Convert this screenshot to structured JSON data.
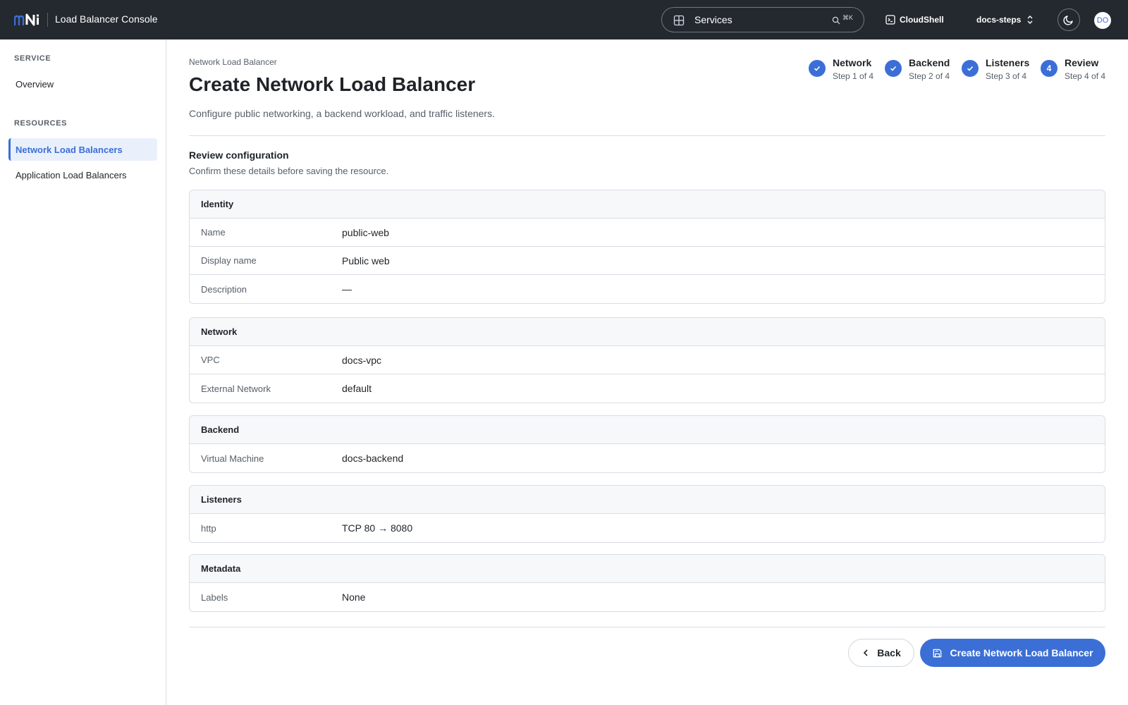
{
  "colors": {
    "accent": "#3b6fd6",
    "topbar": "#24292f"
  },
  "topbar": {
    "logo_text": "mNi",
    "app_title": "Load Balancer Console",
    "search": {
      "label": "Services",
      "shortcut": "⌘K"
    },
    "cloudshell_label": "CloudShell",
    "project_label": "docs-steps",
    "avatar_initials": "DO",
    "icons": [
      "grid-icon",
      "search-icon",
      "terminal-icon",
      "chevron-up-down-icon",
      "moon-icon"
    ]
  },
  "sidebar": {
    "sections": [
      {
        "heading": "SERVICE",
        "items": [
          {
            "label": "Overview",
            "active": false
          }
        ]
      },
      {
        "heading": "RESOURCES",
        "items": [
          {
            "label": "Network Load Balancers",
            "active": true
          },
          {
            "label": "Application Load Balancers",
            "active": false
          }
        ]
      }
    ]
  },
  "page": {
    "breadcrumb": "Network Load Balancer",
    "title": "Create Network Load Balancer",
    "subtitle": "Configure public networking, a backend workload, and traffic listeners."
  },
  "stepper": [
    {
      "name": "Network",
      "sub": "Step 1 of 4",
      "state": "complete"
    },
    {
      "name": "Backend",
      "sub": "Step 2 of 4",
      "state": "complete"
    },
    {
      "name": "Listeners",
      "sub": "Step 3 of 4",
      "state": "complete"
    },
    {
      "name": "Review",
      "sub": "Step 4 of 4",
      "state": "current",
      "number": "4"
    }
  ],
  "review": {
    "title": "Review configuration",
    "subtitle": "Confirm these details before saving the resource.",
    "cards": [
      {
        "title": "Identity",
        "rows": [
          {
            "key": "Name",
            "value": "public-web"
          },
          {
            "key": "Display name",
            "value": "Public web"
          },
          {
            "key": "Description",
            "value": "—"
          }
        ]
      },
      {
        "title": "Network",
        "rows": [
          {
            "key": "VPC",
            "value": "docs-vpc"
          },
          {
            "key": "External Network",
            "value": "default"
          }
        ]
      },
      {
        "title": "Backend",
        "rows": [
          {
            "key": "Virtual Machine",
            "value": "docs-backend"
          }
        ]
      },
      {
        "title": "Listeners",
        "rows": [
          {
            "key": "http",
            "value": "TCP 80 → 8080"
          }
        ]
      },
      {
        "title": "Metadata",
        "rows": [
          {
            "key": "Labels",
            "value": "None"
          }
        ]
      }
    ]
  },
  "actions": {
    "back_label": "Back",
    "create_label": "Create Network Load Balancer"
  }
}
